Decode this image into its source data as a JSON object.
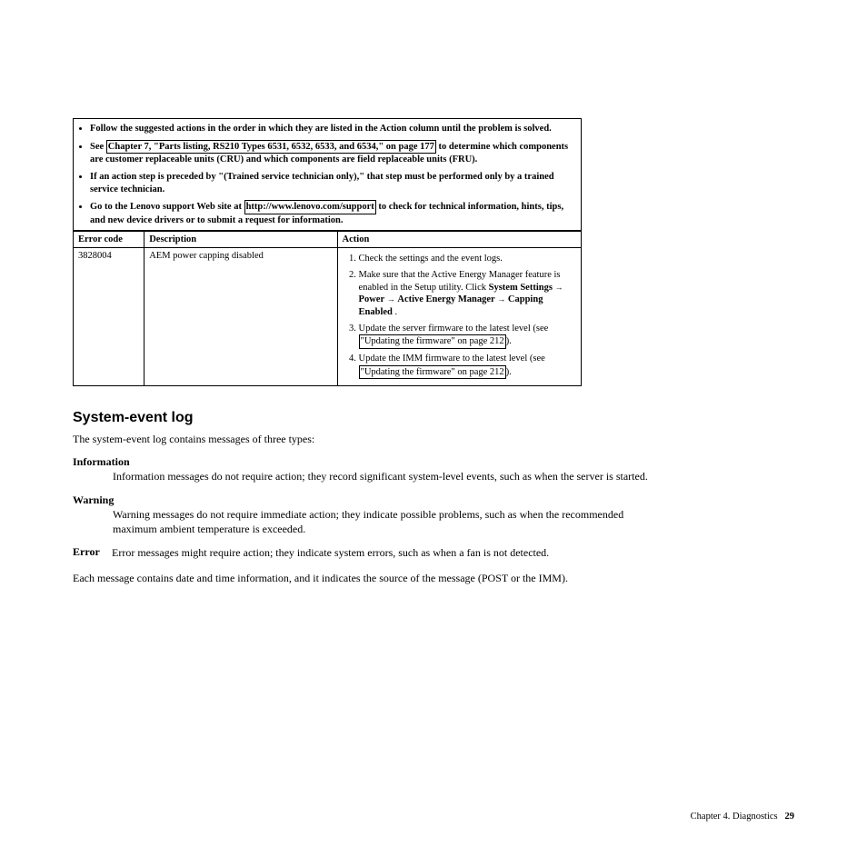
{
  "notices": {
    "b1_a": "Follow the suggested actions in the order in which they are listed in the Action column until the problem is solved.",
    "b2_a": "See ",
    "b2_link": "Chapter 7, \"Parts listing, RS210 Types 6531, 6532, 6533, and 6534,\" on page 177",
    "b2_b": " to determine which components are customer replaceable units (CRU) and which components are field replaceable units (FRU).",
    "b3_a": "If an action step is preceded by \"(Trained service technician only),\" that step must be performed only by a trained service technician.",
    "b4_a": "Go to the Lenovo support Web site at ",
    "b4_link": "http://www.lenovo.com/support",
    "b4_b": " to check for technical information, hints, tips, and new device drivers or to submit a request for information."
  },
  "columns": {
    "code": "Error code",
    "desc": "Description",
    "action": "Action"
  },
  "row": {
    "code": "3828004",
    "desc": "AEM power capping disabled",
    "a1": "Check the settings and the event logs.",
    "a2_a": "Make sure that the Active Energy Manager feature is enabled in the Setup utility. Click ",
    "a2_b": "System Settings",
    "a2_c": "Power",
    "a2_d": "Active Energy Manager",
    "a2_e": "Capping Enabled",
    "a2_f": " .",
    "a3_a": "Update the server firmware to the latest level (see ",
    "a3_link": "\"Updating the firmware\" on page 212",
    "a3_b": ").",
    "a4_a": "Update the IMM firmware to the latest level (see ",
    "a4_link": "\"Updating the firmware\" on page 212",
    "a4_b": ")."
  },
  "section_heading": "System-event log",
  "intro": "The system-event log contains messages of three types:",
  "defs": {
    "info_t": "Information",
    "info_d": "Information messages do not require action; they record significant system-level events, such as when the server is started.",
    "warn_t": "Warning",
    "warn_d": "Warning messages do not require immediate action; they indicate possible problems, such as when the recommended maximum ambient temperature is exceeded.",
    "err_t": "Error",
    "err_d": "Error messages might require action; they indicate system errors, such as when a fan is not detected."
  },
  "closing": "Each message contains date and time information, and it indicates the source of the message (POST or the IMM).",
  "footer": {
    "chapter": "Chapter 4. Diagnostics",
    "page": "29"
  }
}
